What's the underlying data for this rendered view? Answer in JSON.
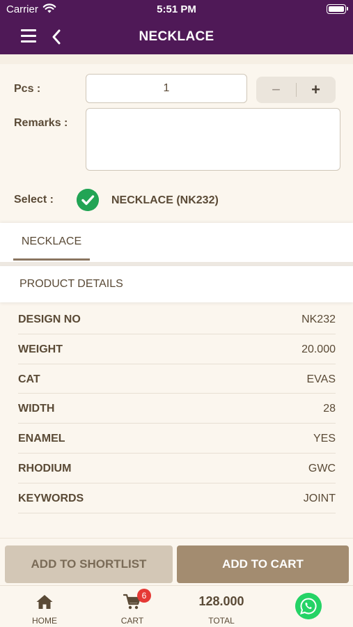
{
  "status_bar": {
    "carrier": "Carrier",
    "time": "5:51 PM"
  },
  "nav": {
    "title": "NECKLACE"
  },
  "form": {
    "pcs_label": "Pcs :",
    "pcs_value": "1",
    "stepper_minus": "−",
    "stepper_plus": "+",
    "remarks_label": "Remarks :",
    "remarks_value": "",
    "select_label": "Select :",
    "select_value": "NECKLACE (NK232)"
  },
  "tabs": [
    {
      "label": "NECKLACE",
      "active": true
    }
  ],
  "section_title": "PRODUCT DETAILS",
  "details": [
    {
      "key": "DESIGN NO",
      "value": "NK232"
    },
    {
      "key": "WEIGHT",
      "value": "20.000"
    },
    {
      "key": "CAT",
      "value": "EVAS"
    },
    {
      "key": "WIDTH",
      "value": "28"
    },
    {
      "key": "ENAMEL",
      "value": "YES"
    },
    {
      "key": "RHODIUM",
      "value": "GWC"
    },
    {
      "key": "KEYWORDS",
      "value": "JOINT"
    }
  ],
  "actions": {
    "shortlist_label": "ADD TO SHORTLIST",
    "cart_label": "ADD TO CART"
  },
  "bottom_nav": {
    "home_label": "HOME",
    "cart_label": "CART",
    "cart_badge": "6",
    "total_amount": "128.000",
    "total_label": "TOTAL"
  },
  "colors": {
    "header": "#4f1957",
    "accent": "#a38c70",
    "background": "#fbf6ee",
    "check": "#22a455",
    "whatsapp": "#25d366",
    "badge": "#e53935"
  }
}
